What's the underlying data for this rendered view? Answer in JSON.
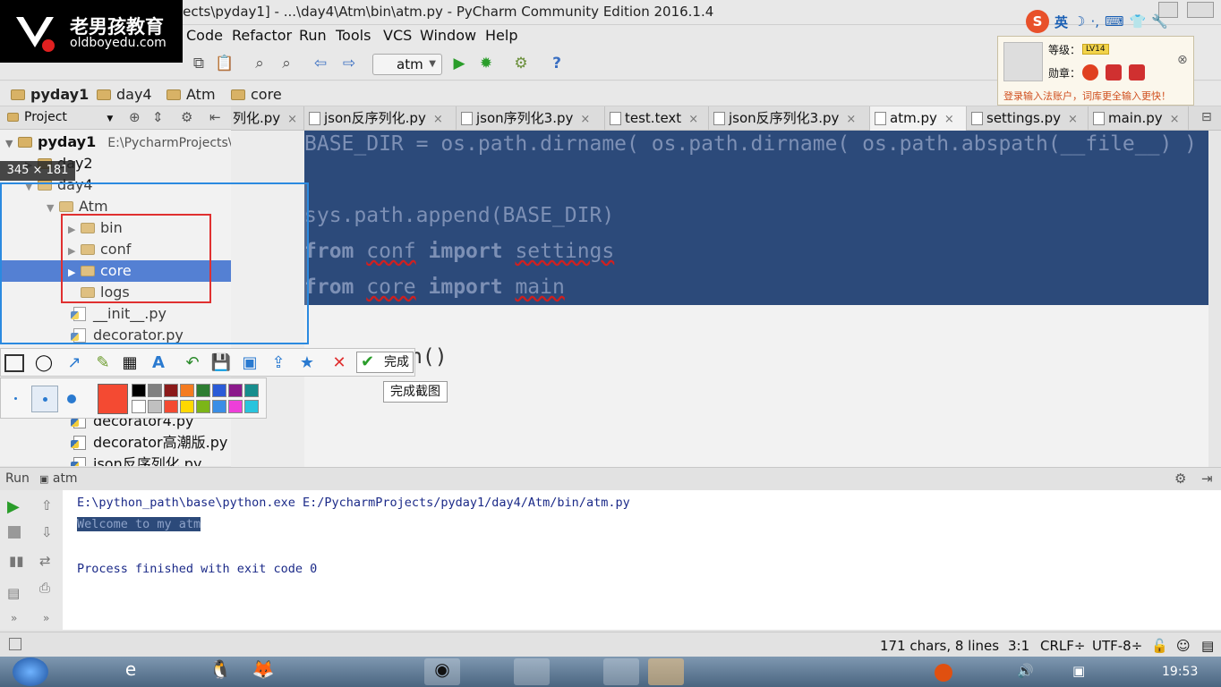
{
  "window": {
    "title": "jects\\pyday1] - ...\\day4\\Atm\\bin\\atm.py - PyCharm Community Edition 2016.1.4"
  },
  "logo": {
    "cn": "老男孩教育",
    "en": "oldboyedu.com"
  },
  "menu": [
    "Code",
    "Refactor",
    "Run",
    "Tools",
    "VCS",
    "Window",
    "Help"
  ],
  "toolbar": {
    "run_config": "atm"
  },
  "breadcrumbs": [
    "pyday1",
    "day4",
    "Atm",
    "core"
  ],
  "project_panel": {
    "title": "Project",
    "root": {
      "name": "pyday1",
      "path": "E:\\PycharmProjects\\"
    },
    "items": [
      {
        "label": "day2",
        "kind": "folder"
      },
      {
        "label": "day4",
        "kind": "folder"
      },
      {
        "label": "Atm",
        "kind": "folder"
      },
      {
        "label": "bin",
        "kind": "package"
      },
      {
        "label": "conf",
        "kind": "package"
      },
      {
        "label": "core",
        "kind": "package",
        "selected": true
      },
      {
        "label": "logs",
        "kind": "package"
      },
      {
        "label": "__init__.py",
        "kind": "file"
      },
      {
        "label": "decorator.py",
        "kind": "file"
      },
      {
        "label": "decorator4.py",
        "kind": "file"
      },
      {
        "label": "decorator高潮版.py",
        "kind": "file"
      },
      {
        "label": "json反序列化.py",
        "kind": "file"
      }
    ]
  },
  "tabs": [
    {
      "label": "列化.py",
      "close": "×"
    },
    {
      "label": "json反序列化.py",
      "close": "×"
    },
    {
      "label": "json序列化3.py",
      "close": "×"
    },
    {
      "label": "test.text",
      "close": "×"
    },
    {
      "label": "json反序列化3.py",
      "close": "×"
    },
    {
      "label": "atm.py",
      "close": "×",
      "active": true
    },
    {
      "label": "settings.py",
      "close": "×"
    },
    {
      "label": "main.py",
      "close": "×"
    }
  ],
  "editor": {
    "line1": "BASE_DIR = os.path.dirname( os.path.dirname( os.path.abspath(__file__) )",
    "line2": "sys.path.append(BASE_DIR)",
    "kw_from": "from",
    "kw_import": "import",
    "mod_conf": "conf",
    "mod_settings": "settings",
    "mod_core": "core",
    "mod_main": "main",
    "line_call": "n()"
  },
  "run_panel": {
    "label": "Run",
    "config": "atm",
    "output": [
      "E:\\python_path\\base\\python.exe E:/PycharmProjects/pyday1/day4/Atm/bin/atm.py",
      "Welcome to my atm",
      "Process finished with exit code 0"
    ]
  },
  "status_bar": {
    "chars": "171 chars, 8 lines",
    "position": "3:1",
    "line_sep": "CRLF÷",
    "encoding": "UTF-8÷"
  },
  "taskbar": {
    "time": "19:53"
  },
  "screenshot_tool": {
    "size_label": "345 × 181",
    "done_label": "完成",
    "tooltip": "完成截图",
    "current_color": "#f44a32",
    "swatches": [
      "#000000",
      "#808080",
      "#8b1a1a",
      "#f47b20",
      "#2e7d32",
      "#2a5bd7",
      "#8b1a8b",
      "#178d8d",
      "#ffffff",
      "#c0c0c0",
      "#f44a32",
      "#ffd800",
      "#7cb518",
      "#3a8ee6",
      "#ee3fd9",
      "#29c4dd"
    ]
  },
  "ime": {
    "lang": "英",
    "level_label": "等级：",
    "level_badge": "LV14",
    "medal_label": "勋章：",
    "notice": "登录输入法账户，词库更全输入更快！"
  },
  "colors": {
    "selection": "#2c4a7a",
    "tree_selected": "#2f65ca",
    "capture_border": "#2b8ae0",
    "annotation_red": "#e03030"
  }
}
